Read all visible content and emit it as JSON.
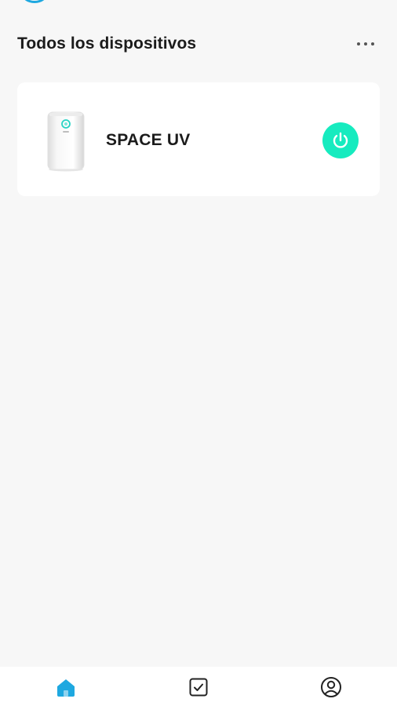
{
  "header": {
    "title": "Todos los dispositivos",
    "more_icon": "more-horizontal-icon"
  },
  "devices": [
    {
      "name": "SPACE UV",
      "image": "air-purifier",
      "power_icon": "power-icon",
      "power_state": "on",
      "power_color": "#16ebbf"
    }
  ],
  "bottom_nav": {
    "items": [
      {
        "icon": "home-icon",
        "active": true,
        "color": "#1ea8e0"
      },
      {
        "icon": "task-check-icon",
        "active": false,
        "color": "#222222"
      },
      {
        "icon": "user-profile-icon",
        "active": false,
        "color": "#222222"
      }
    ]
  },
  "colors": {
    "background": "#f7f7f7",
    "card": "#ffffff",
    "accent": "#1ea8e0",
    "power": "#16ebbf"
  }
}
